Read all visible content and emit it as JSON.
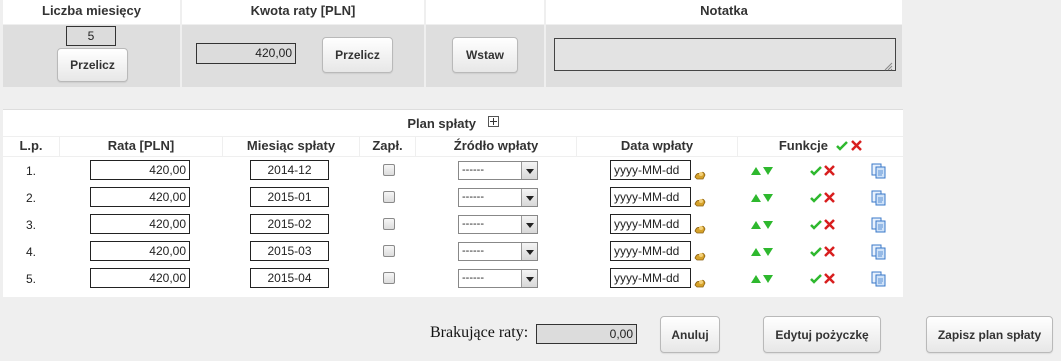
{
  "top": {
    "col1_header": "Liczba miesięcy",
    "col2_header": "Kwota raty [PLN]",
    "col4_header": "Notatka",
    "months_value": "5",
    "recalc_months_label": "Przelicz",
    "installment_value": "420,00",
    "recalc_amount_label": "Przelicz",
    "insert_label": "Wstaw",
    "note_value": ""
  },
  "plan": {
    "title": "Plan spłaty",
    "expand_icon": "plus-box-icon",
    "columns": [
      "L.p.",
      "Rata [PLN]",
      "Miesiąc spłaty",
      "Zapł.",
      "Źródło wpłaty",
      "Data wpłaty",
      "Funkcje"
    ],
    "rows": [
      {
        "lp": "1.",
        "rata": "420,00",
        "month": "2014-12",
        "source": "------",
        "date_placeholder": "yyyy-MM-dd"
      },
      {
        "lp": "2.",
        "rata": "420,00",
        "month": "2015-01",
        "source": "------",
        "date_placeholder": "yyyy-MM-dd"
      },
      {
        "lp": "3.",
        "rata": "420,00",
        "month": "2015-02",
        "source": "------",
        "date_placeholder": "yyyy-MM-dd"
      },
      {
        "lp": "4.",
        "rata": "420,00",
        "month": "2015-03",
        "source": "------",
        "date_placeholder": "yyyy-MM-dd"
      },
      {
        "lp": "5.",
        "rata": "420,00",
        "month": "2015-04",
        "source": "------",
        "date_placeholder": "yyyy-MM-dd"
      }
    ]
  },
  "footer": {
    "missing_label": "Brakujące raty:",
    "missing_value": "0,00",
    "cancel_label": "Anuluj",
    "edit_loan_label": "Edytuj pożyczkę",
    "save_plan_label": "Zapisz plan spłaty"
  },
  "colors": {
    "green": "#2eb82e",
    "red": "#d81e1e",
    "blue_icon": "#3a78c8"
  }
}
